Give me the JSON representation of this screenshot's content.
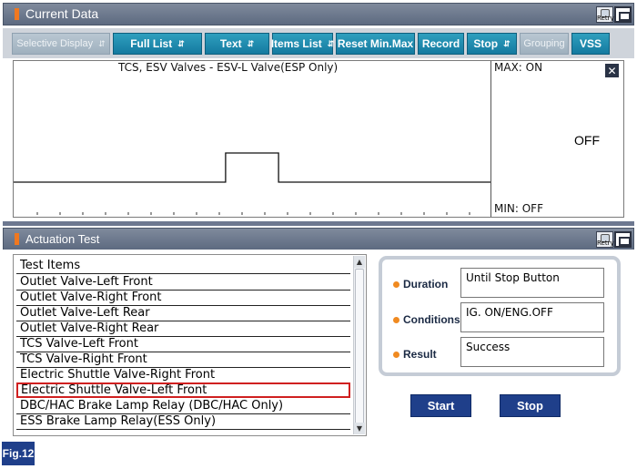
{
  "current_data": {
    "title": "Current Data",
    "retry_label": "Retry",
    "toolbar": [
      {
        "label": "Selective Display",
        "disabled": true,
        "has_arrows": true
      },
      {
        "label": "Full List",
        "disabled": false,
        "has_arrows": true
      },
      {
        "label": "Text",
        "disabled": false,
        "has_arrows": true
      },
      {
        "label": "Items List",
        "disabled": false,
        "has_arrows": true
      },
      {
        "label": "Reset Min.Max",
        "disabled": false,
        "has_arrows": false
      },
      {
        "label": "Record",
        "disabled": false,
        "has_arrows": false
      },
      {
        "label": "Stop",
        "disabled": false,
        "has_arrows": true
      },
      {
        "label": "Grouping",
        "disabled": true,
        "has_arrows": false
      },
      {
        "label": "VSS",
        "disabled": false,
        "has_arrows": false
      }
    ],
    "graph": {
      "title": "TCS, ESV Valves - ESV-L Valve(ESP Only)",
      "max_label": "MAX: ON",
      "min_label": "MIN: OFF",
      "current_value": "OFF",
      "signal": [
        "OFF",
        "OFF",
        "OFF",
        "OFF",
        "ON",
        "OFF",
        "OFF",
        "OFF",
        "OFF"
      ]
    }
  },
  "actuation_test": {
    "title": "Actuation Test",
    "retry_label": "Retry",
    "list_header": "Test Items",
    "items": [
      "Outlet Valve-Left Front",
      "Outlet Valve-Right Front",
      "Outlet Valve-Left Rear",
      "Outlet Valve-Right Rear",
      "TCS Valve-Left Front",
      "TCS Valve-Right Front",
      "Electric Shuttle Valve-Right Front",
      "Electric Shuttle Valve-Left Front",
      "DBC/HAC Brake Lamp Relay (DBC/HAC Only)",
      "ESS Brake Lamp Relay(ESS Only)"
    ],
    "selected_item": "Electric Shuttle Valve-Left Front",
    "duration": {
      "label": "Duration",
      "value": "Until Stop Button"
    },
    "conditions": {
      "label": "Conditions",
      "value": "IG. ON/ENG.OFF"
    },
    "result": {
      "label": "Result",
      "value": "Success"
    },
    "start_label": "Start",
    "stop_label": "Stop"
  },
  "figure_label": "Fig.12",
  "colors": {
    "accent": "#f07820",
    "button": "#147aa0",
    "action_button": "#1f3f8a",
    "selected_border": "#d02020"
  }
}
